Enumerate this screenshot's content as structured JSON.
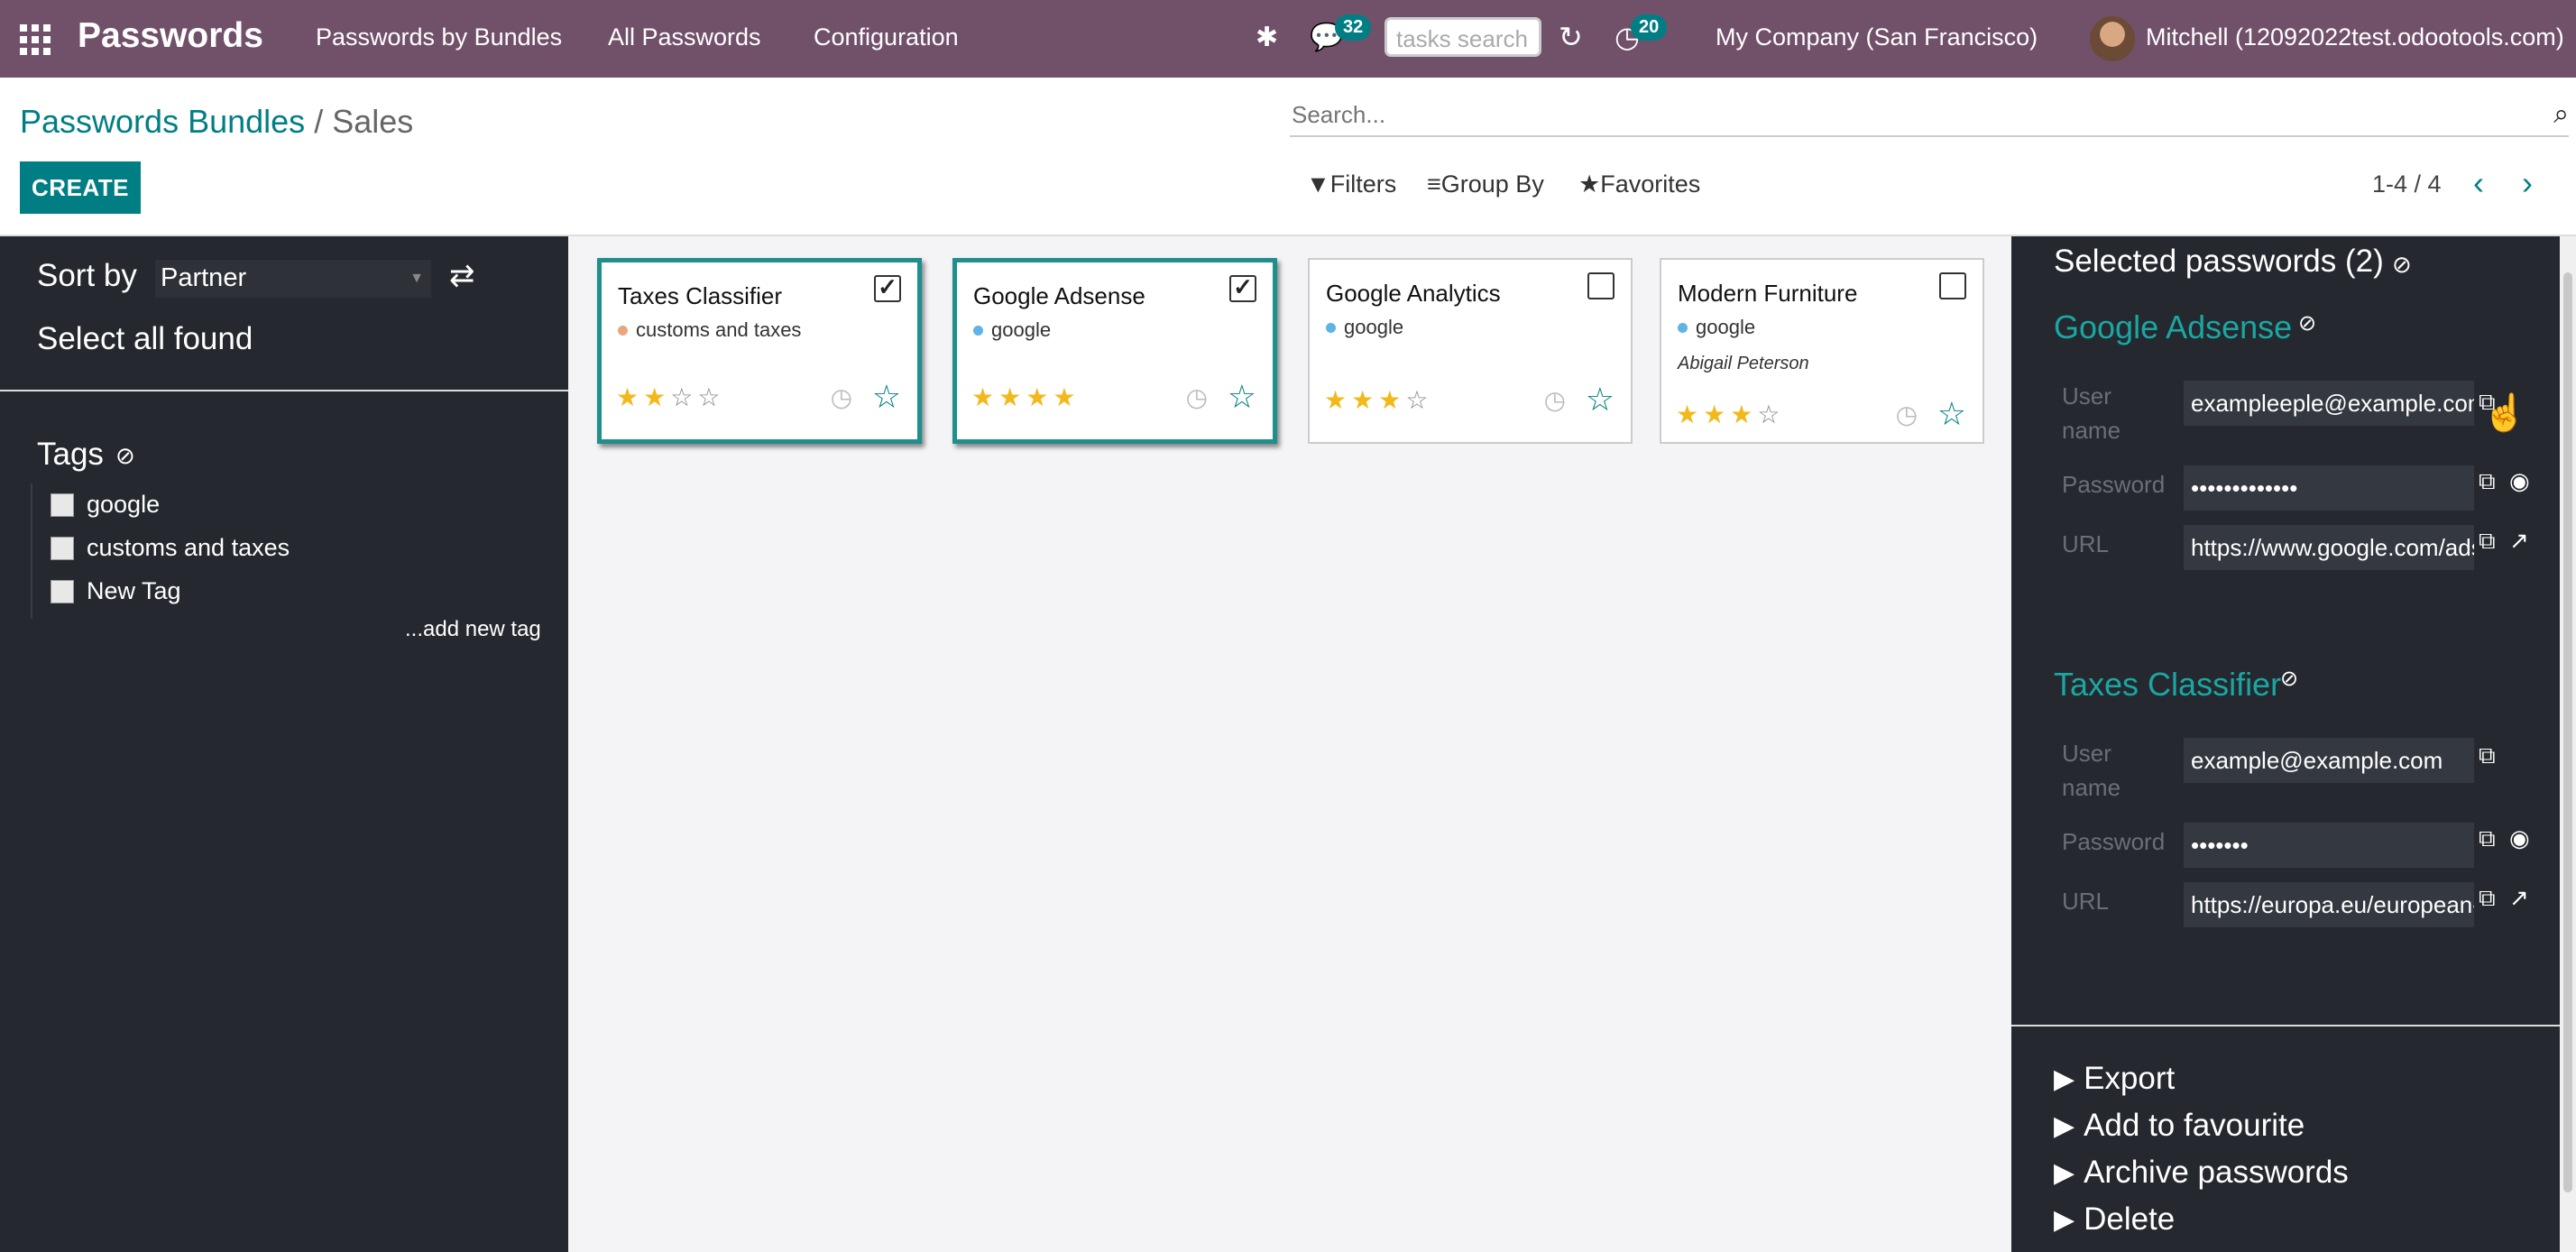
{
  "navbar": {
    "app_name": "Passwords",
    "menus": [
      "Passwords by Bundles",
      "All Passwords",
      "Configuration"
    ],
    "messages_count": "32",
    "tasks_search_placeholder": "tasks search",
    "activities_count": "20",
    "company": "My Company (San Francisco)",
    "user": "Mitchell (12092022test.odootools.com)"
  },
  "control_panel": {
    "breadcrumb_parent": "Passwords Bundles",
    "breadcrumb_separator": "/",
    "breadcrumb_current": "Sales",
    "create_label": "CREATE",
    "search_placeholder": "Search...",
    "filters_label": "Filters",
    "group_by_label": "Group By",
    "favorites_label": "Favorites",
    "pager": "1-4 / 4"
  },
  "sidebar": {
    "sort_label": "Sort by",
    "sort_value": "Partner",
    "select_all": "Select all found",
    "tags_title": "Tags",
    "tags": [
      "google",
      "customs and taxes",
      "New Tag"
    ],
    "add_tag": "...add new tag"
  },
  "cards": [
    {
      "title": "Taxes Classifier",
      "tag": "customs and taxes",
      "tag_color": "#e8a87c",
      "partner": "",
      "rating": 2,
      "selected": true
    },
    {
      "title": "Google Adsense",
      "tag": "google",
      "tag_color": "#5fb3e5",
      "partner": "",
      "rating": 4,
      "selected": true
    },
    {
      "title": "Google Analytics",
      "tag": "google",
      "tag_color": "#5fb3e5",
      "partner": "",
      "rating": 3,
      "selected": false
    },
    {
      "title": "Modern Furniture",
      "tag": "google",
      "tag_color": "#5fb3e5",
      "partner": "Abigail Peterson",
      "rating": 3,
      "selected": false
    }
  ],
  "panel": {
    "title": "Selected passwords (2)",
    "passwords": [
      {
        "name": "Google Adsense",
        "user_label": "User name",
        "user": "exampleeple@example.com",
        "password_label": "Password",
        "password": "•••••••••••••",
        "url_label": "URL",
        "url": "https://www.google.com/adsense"
      },
      {
        "name": "Taxes Classifier",
        "user_label": "User name",
        "user": "example@example.com",
        "password_label": "Password",
        "password": "•••••••",
        "url_label": "URL",
        "url": "https://europa.eu/european-union"
      }
    ],
    "actions": [
      "Export",
      "Add to favourite",
      "Archive passwords",
      "Delete"
    ]
  },
  "colors": {
    "navbar": "#71506a",
    "accent": "#017e84",
    "panel_bg": "#25292f",
    "star": "#f3b81a"
  }
}
